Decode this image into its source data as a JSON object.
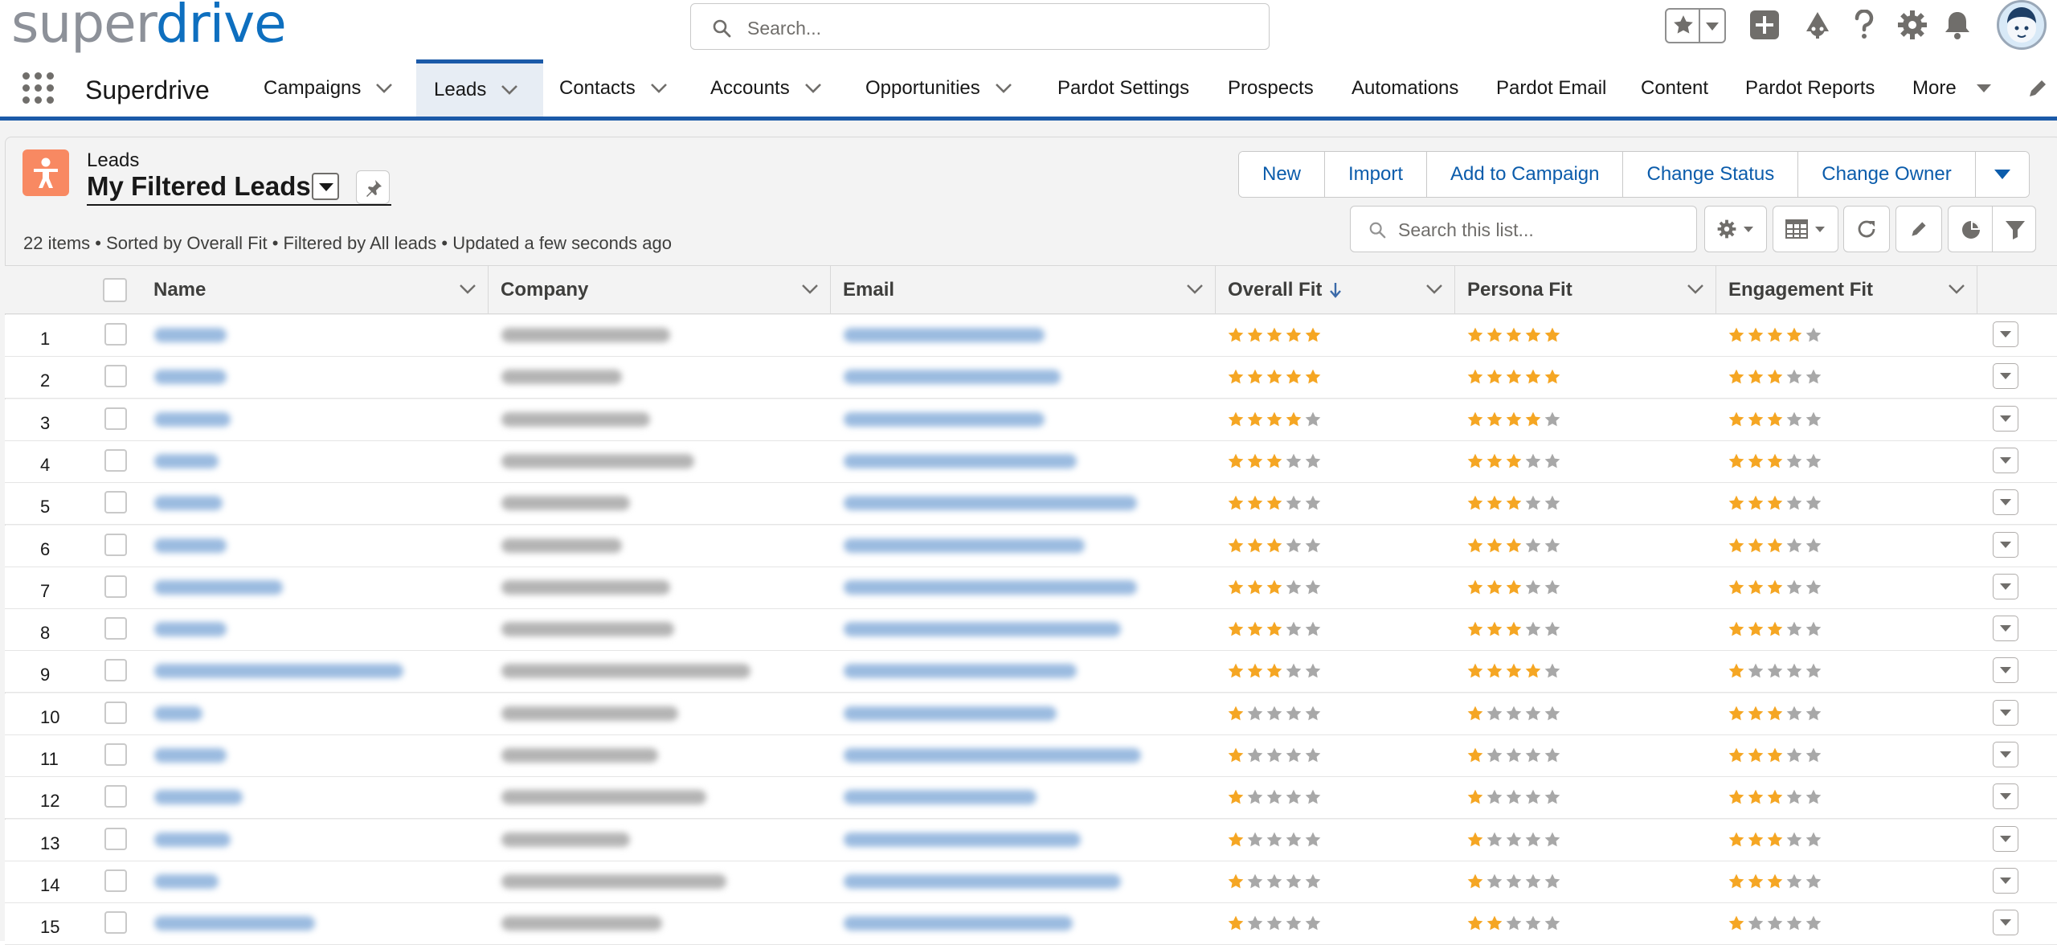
{
  "app": {
    "logo_part1": "super",
    "logo_part2": "drive",
    "name": "Superdrive"
  },
  "global_search": {
    "placeholder": "Search..."
  },
  "nav": [
    {
      "label": "Campaigns",
      "dropdown": true
    },
    {
      "label": "Leads",
      "dropdown": true,
      "active": true
    },
    {
      "label": "Contacts",
      "dropdown": true
    },
    {
      "label": "Accounts",
      "dropdown": true
    },
    {
      "label": "Opportunities",
      "dropdown": true
    },
    {
      "label": "Pardot Settings",
      "dropdown": false
    },
    {
      "label": "Prospects",
      "dropdown": false
    },
    {
      "label": "Automations",
      "dropdown": false
    },
    {
      "label": "Pardot Email",
      "dropdown": false
    },
    {
      "label": "Content",
      "dropdown": false
    },
    {
      "label": "Pardot Reports",
      "dropdown": false
    },
    {
      "label": "More",
      "dropdown": true
    }
  ],
  "list": {
    "object_label": "Leads",
    "view_name": "My Filtered Leads",
    "meta": "22 items • Sorted by Overall Fit • Filtered by All leads • Updated a few seconds ago",
    "search_placeholder": "Search this list..."
  },
  "actions": [
    "New",
    "Import",
    "Add to Campaign",
    "Change Status",
    "Change Owner"
  ],
  "columns": [
    "Name",
    "Company",
    "Email",
    "Overall Fit",
    "Persona Fit",
    "Engagement Fit"
  ],
  "colors": {
    "star_on": "#f5a623",
    "star_off": "#a8a8a8",
    "brand_blue": "#1b5aa8",
    "link": "#0b5cab",
    "lead_icon": "#f88962"
  },
  "rows": [
    {
      "num": "1",
      "overall": 5,
      "persona": 5,
      "engagement": 4
    },
    {
      "num": "2",
      "overall": 5,
      "persona": 5,
      "engagement": 3
    },
    {
      "num": "3",
      "overall": 4,
      "persona": 4,
      "engagement": 3
    },
    {
      "num": "4",
      "overall": 3,
      "persona": 3,
      "engagement": 3
    },
    {
      "num": "5",
      "overall": 3,
      "persona": 3,
      "engagement": 3
    },
    {
      "num": "6",
      "overall": 3,
      "persona": 3,
      "engagement": 3
    },
    {
      "num": "7",
      "overall": 3,
      "persona": 3,
      "engagement": 3
    },
    {
      "num": "8",
      "overall": 3,
      "persona": 3,
      "engagement": 3
    },
    {
      "num": "9",
      "overall": 3,
      "persona": 4,
      "engagement": 1
    },
    {
      "num": "10",
      "overall": 1,
      "persona": 1,
      "engagement": 3
    },
    {
      "num": "11",
      "overall": 1,
      "persona": 1,
      "engagement": 3
    },
    {
      "num": "12",
      "overall": 1,
      "persona": 1,
      "engagement": 3
    },
    {
      "num": "13",
      "overall": 1,
      "persona": 1,
      "engagement": 3
    },
    {
      "num": "14",
      "overall": 1,
      "persona": 1,
      "engagement": 3
    },
    {
      "num": "15",
      "overall": 1,
      "persona": 2,
      "engagement": 1
    }
  ]
}
